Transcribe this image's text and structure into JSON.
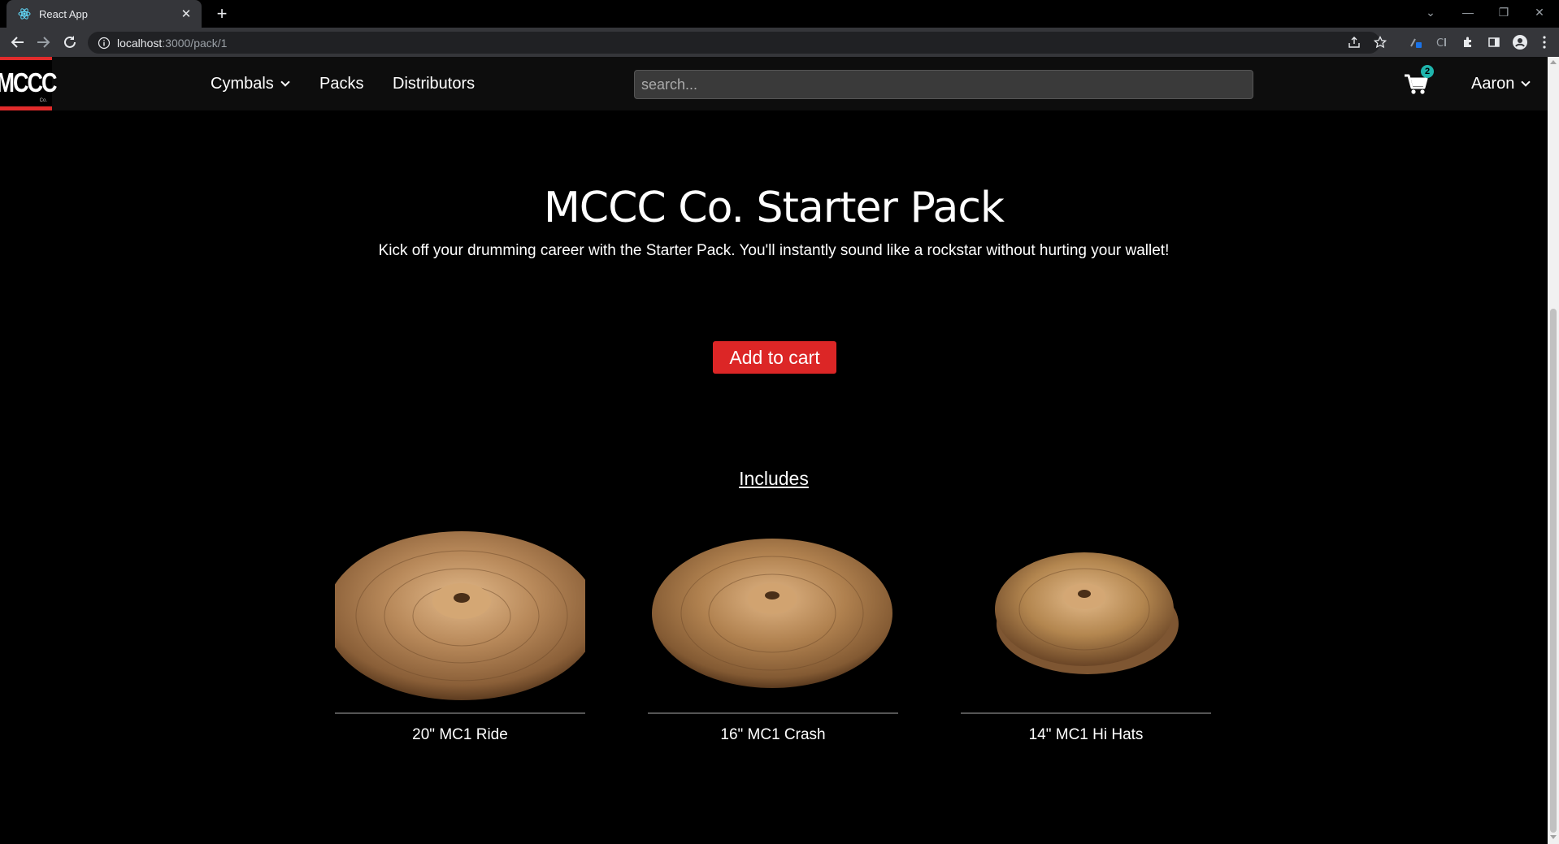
{
  "browser": {
    "tab_title": "React App",
    "url_host": "localhost",
    "url_path": ":3000/pack/1"
  },
  "nav": {
    "logo_text": "MCCC",
    "logo_sub": "Co.",
    "links": [
      "Cymbals",
      "Packs",
      "Distributors"
    ],
    "search_placeholder": "search...",
    "cart_count": "2",
    "user": "Aaron"
  },
  "pack": {
    "title": "MCCC Co. Starter Pack",
    "description": "Kick off your drumming career with the Starter Pack. You'll instantly sound like a rockstar without hurting your wallet!",
    "add_to_cart_label": "Add to cart",
    "includes_label": "Includes"
  },
  "products": [
    {
      "name": "20\" MC1 Ride"
    },
    {
      "name": "16\" MC1 Crash"
    },
    {
      "name": "14\" MC1 Hi Hats"
    }
  ],
  "colors": {
    "accent_red": "#dc2626",
    "badge_teal": "#1fb5ad",
    "bronze": "#b8895a"
  }
}
